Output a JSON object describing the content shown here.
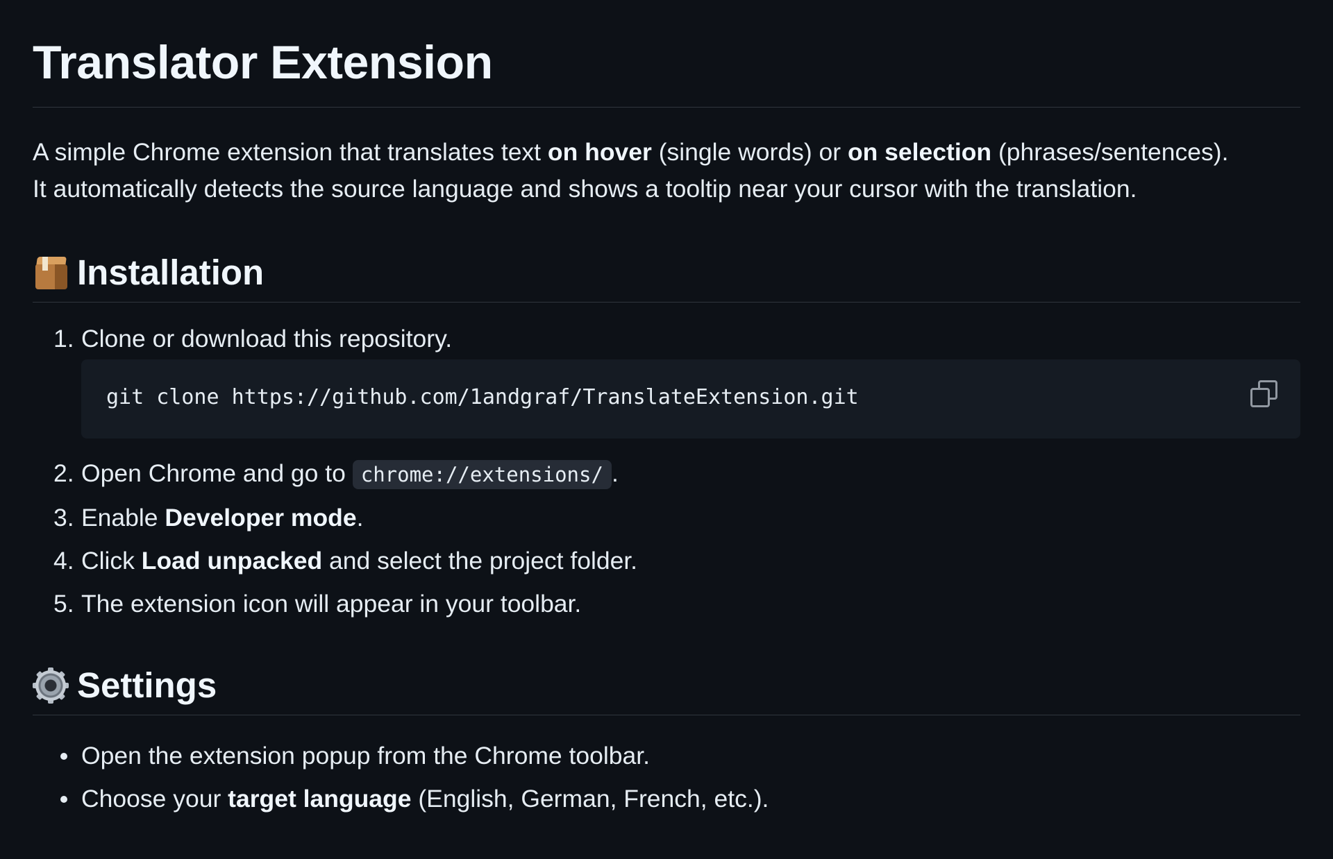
{
  "title": "Translator Extension",
  "intro": {
    "line1_a": "A simple Chrome extension that translates text ",
    "line1_b": "on hover",
    "line1_c": " (single words) or ",
    "line1_d": "on selection",
    "line1_e": " (phrases/sentences).",
    "line2": "It automatically detects the source language and shows a tooltip near your cursor with the translation."
  },
  "installation": {
    "icon": "package-icon",
    "heading": "Installation",
    "steps": [
      {
        "num": "1.",
        "text": "Clone or download this repository."
      },
      {
        "num": "2.",
        "text_a": "Open Chrome and go to ",
        "code": "chrome://extensions/",
        "text_b": "."
      },
      {
        "num": "3.",
        "text_a": "Enable ",
        "bold": "Developer mode",
        "text_b": "."
      },
      {
        "num": "4.",
        "text_a": "Click ",
        "bold": "Load unpacked",
        "text_b": " and select the project folder."
      },
      {
        "num": "5.",
        "text": "The extension icon will appear in your toolbar."
      }
    ],
    "code_block": "git clone https://github.com/1andgraf/TranslateExtension.git",
    "copy_icon": "copy-icon"
  },
  "settings": {
    "icon": "gear-icon",
    "heading": "Settings",
    "bullets": [
      {
        "text": "Open the extension popup from the Chrome toolbar."
      },
      {
        "text_a": "Choose your ",
        "bold": "target language",
        "text_b": " (English, German, French, etc.)."
      }
    ]
  },
  "colors": {
    "background": "#0d1117",
    "text": "#e6edf3",
    "border": "#30363d",
    "code_bg": "#151b23",
    "inline_code_bg": "#262c36"
  }
}
